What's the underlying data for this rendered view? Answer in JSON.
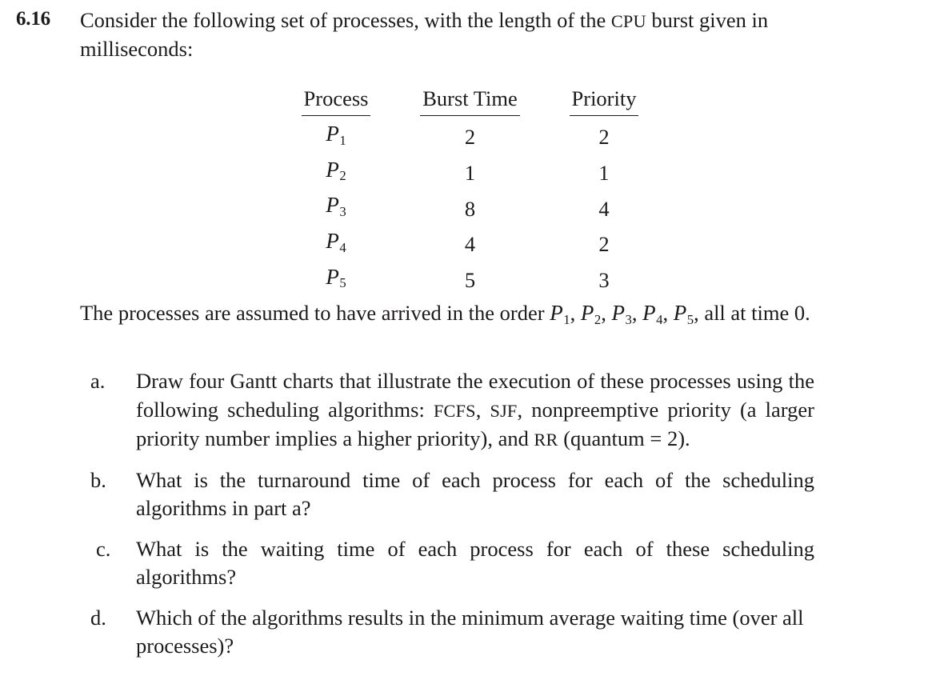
{
  "exercise": {
    "number": "6.16",
    "prompt_part1": "Consider the following set of processes, with the length of the ",
    "prompt_cpu": "CPU",
    "prompt_part2": " burst given in milliseconds:"
  },
  "table": {
    "headers": [
      "Process",
      "Burst Time",
      "Priority"
    ],
    "rows": [
      {
        "process": "P",
        "index": "1",
        "burst": "2",
        "priority": "2"
      },
      {
        "process": "P",
        "index": "2",
        "burst": "1",
        "priority": "1"
      },
      {
        "process": "P",
        "index": "3",
        "burst": "8",
        "priority": "4"
      },
      {
        "process": "P",
        "index": "4",
        "burst": "4",
        "priority": "2"
      },
      {
        "process": "P",
        "index": "5",
        "burst": "5",
        "priority": "3"
      }
    ]
  },
  "arrival": {
    "lead": "The processes are assumed to have arrived in the order ",
    "order": [
      "1",
      "2",
      "3",
      "4",
      "5"
    ],
    "tail": " all at time 0."
  },
  "questions": [
    {
      "marker": "a.",
      "segments": [
        {
          "type": "text",
          "value": "Draw four Gantt charts that illustrate the execution of these processes using the following scheduling algorithms: "
        },
        {
          "type": "smallcaps",
          "value": "FCFS"
        },
        {
          "type": "text",
          "value": ", "
        },
        {
          "type": "smallcaps",
          "value": "SJF"
        },
        {
          "type": "text",
          "value": ", nonpreemptive priority (a larger priority number implies a higher priority), and "
        },
        {
          "type": "smallcaps",
          "value": "RR"
        },
        {
          "type": "text",
          "value": " (quantum = 2)."
        }
      ]
    },
    {
      "marker": "b.",
      "segments": [
        {
          "type": "text",
          "value": "What is the turnaround time of each process for each of the scheduling algorithms in part a?"
        }
      ]
    },
    {
      "marker": "c.",
      "segments": [
        {
          "type": "text",
          "value": "What is the waiting time of each process for each of these scheduling algorithms?"
        }
      ]
    },
    {
      "marker": "d.",
      "segments": [
        {
          "type": "text",
          "value": "Which of the algorithms results in the minimum average waiting time (over all processes)?"
        }
      ]
    }
  ],
  "colors": {
    "text": "#1c1a1b",
    "background": "#ffffff"
  }
}
